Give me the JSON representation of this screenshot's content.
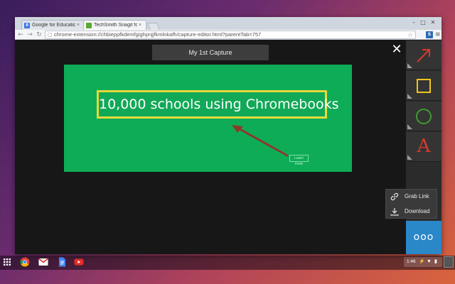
{
  "browser": {
    "tabs": [
      {
        "label": "Google for Education: A",
        "favicon": "8",
        "favicon_color": "#3b78e7",
        "active": false
      },
      {
        "label": "TechSmith Snagit for Go",
        "favicon": "",
        "favicon_color": "#5aa832",
        "active": true
      }
    ],
    "window_controls": [
      "–",
      "□",
      "✕"
    ],
    "url": "chrome-extension://chbieppfkdemfgighpnjjfkmlnkafh/capture-editor.html?parentTab=757",
    "extension_badge": "S",
    "menu_glyph": "≡"
  },
  "editor": {
    "capture_title": "My 1st Capture",
    "close_glyph": "✕",
    "canvas": {
      "headline": "10,000 schools using Chromebooks",
      "small_label": "Learn more",
      "background": "#0fac58",
      "highlight_color": "#e7d93a",
      "arrow_color": "#8a3a2a"
    },
    "tools": [
      {
        "name": "arrow-tool",
        "icon": "arrow-icon"
      },
      {
        "name": "rectangle-tool",
        "icon": "square-icon"
      },
      {
        "name": "ellipse-tool",
        "icon": "circle-icon"
      },
      {
        "name": "text-tool",
        "icon": "text-icon",
        "glyph": "A"
      }
    ],
    "share_menu": {
      "grab_link": "Grab Link",
      "download": "Download"
    },
    "more_glyph": "ooo"
  },
  "shelf": {
    "time": "1:46",
    "apps": [
      "chrome-icon",
      "gmail-icon",
      "docs-icon",
      "youtube-icon"
    ]
  },
  "colors": {
    "accent_blue": "#2a87c8",
    "tool_red": "#d53a2c",
    "tool_yellow": "#f0c419",
    "tool_green": "#3e9c2e"
  }
}
